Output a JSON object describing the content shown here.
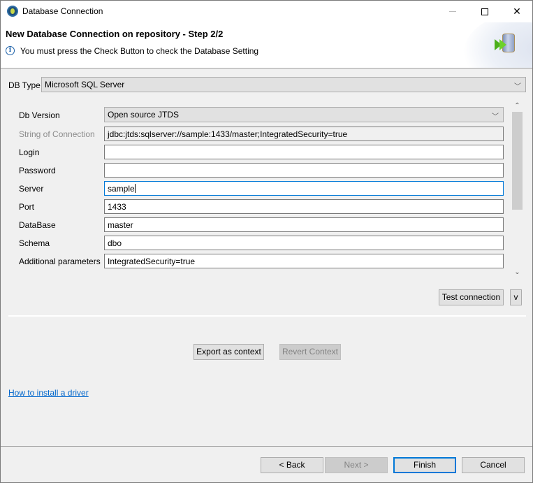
{
  "window": {
    "title": "Database Connection",
    "controls": {
      "minimize": "minimize",
      "maximize": "maximize",
      "close": "close"
    }
  },
  "header": {
    "title": "New Database Connection on repository - Step 2/2",
    "info_icon": "i",
    "message": "You must press the Check Button to check the Database Setting"
  },
  "db_type": {
    "label": "DB Type",
    "value": "Microsoft SQL Server"
  },
  "form": {
    "db_version": {
      "label": "Db Version",
      "value": "Open source JTDS"
    },
    "connection_string": {
      "label": "String of Connection",
      "value": "jdbc:jtds:sqlserver://sample:1433/master;IntegratedSecurity=true"
    },
    "login": {
      "label": "Login",
      "value": ""
    },
    "password": {
      "label": "Password",
      "value": ""
    },
    "server": {
      "label": "Server",
      "value": "sample"
    },
    "port": {
      "label": "Port",
      "value": "1433"
    },
    "database": {
      "label": "DataBase",
      "value": "master"
    },
    "schema": {
      "label": "Schema",
      "value": "dbo"
    },
    "additional_parameters": {
      "label": "Additional parameters",
      "value": "IntegratedSecurity=true"
    }
  },
  "scrollbar": {
    "up": "⌃",
    "down": "⌄"
  },
  "buttons": {
    "test_connection": "Test connection",
    "expand": "v",
    "export_context": "Export as context",
    "revert_context": "Revert Context",
    "back": "< Back",
    "next": "Next >",
    "finish": "Finish",
    "cancel": "Cancel"
  },
  "links": {
    "install_driver": "How to install a driver"
  },
  "chevron": "﹀"
}
